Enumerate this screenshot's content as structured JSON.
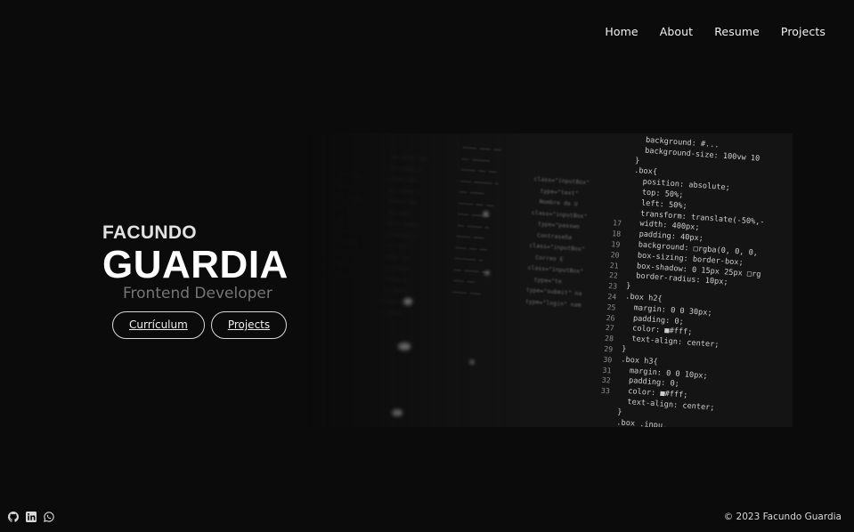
{
  "nav": {
    "items": [
      {
        "label": "Home"
      },
      {
        "label": "About"
      },
      {
        "label": "Resume"
      },
      {
        "label": "Projects"
      }
    ]
  },
  "hero": {
    "first_name": "FACUNDO",
    "last_name": "GUARDIA",
    "role": "Frontend Developer",
    "buttons": [
      {
        "label": "Currículum"
      },
      {
        "label": "Projects"
      }
    ]
  },
  "code_image": {
    "line_numbers": [
      "",
      "",
      "",
      "",
      "",
      "",
      "",
      "",
      "17",
      "18",
      "19",
      "20",
      "21",
      "22",
      "23",
      "24",
      "25",
      "26",
      "27",
      "28",
      "29",
      "30",
      "31",
      "32",
      "33"
    ],
    "lines": [
      "  background: #...",
      "  background-size: 100vw 10",
      "}",
      ".box{",
      "  position: absolute;",
      "  top: 50%;",
      "  left: 50%;",
      "  transform: translate(-50%,-",
      "  width: 400px;",
      "  padding: 40px;",
      "  background: □rgba(0, 0, 0,",
      "  box-sizing: border-box;",
      "  box-shadow: 0 15px 25px □rg",
      "  border-radius: 10px;",
      "}",
      ".box h2{",
      "  margin: 0 0 30px;",
      "  padding: 0;",
      "  color: ■#fff;",
      "  text-align: center;",
      "}",
      ".box h3{",
      "  margin: 0 0 10px;",
      "  padding: 0;",
      "  color: ■#fff;",
      "  text-align: center;",
      "}",
      ".box .inpu..."
    ]
  },
  "footer": {
    "social_icons": [
      "github-icon",
      "linkedin-icon",
      "whatsapp-icon"
    ],
    "copyright": "© 2023 Facundo Guardia"
  },
  "colors": {
    "background": "#0b0b0b",
    "text": "#ffffff",
    "muted": "#767676",
    "button_border": "#d9d9d9"
  }
}
